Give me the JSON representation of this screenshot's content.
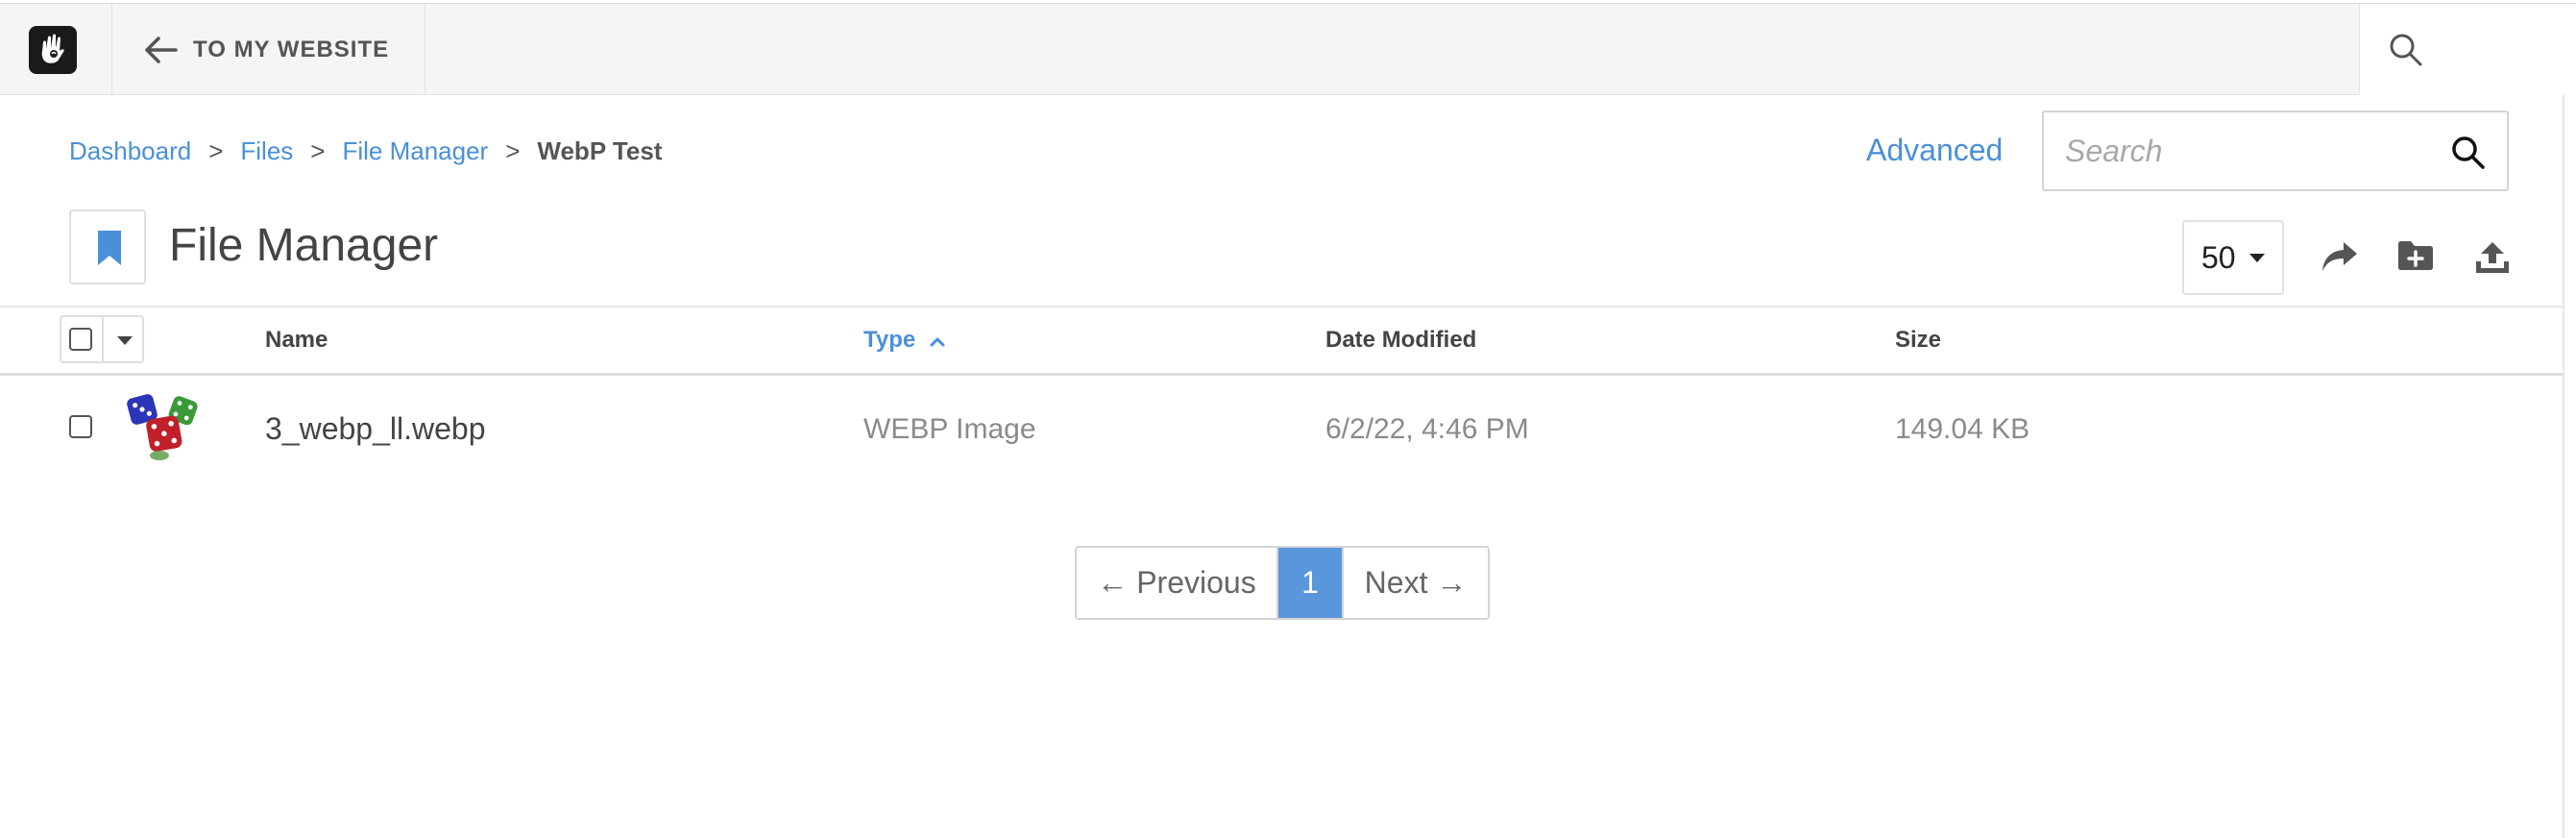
{
  "toolbar": {
    "back_label": "TO MY WEBSITE"
  },
  "breadcrumb": {
    "items": [
      "Dashboard",
      "Files",
      "File Manager"
    ],
    "separator": ">",
    "current": "WebP Test"
  },
  "header": {
    "advanced_label": "Advanced",
    "search_placeholder": "Search",
    "page_title": "File Manager",
    "per_page": "50"
  },
  "table": {
    "columns": {
      "name": "Name",
      "type": "Type",
      "date_modified": "Date Modified",
      "size": "Size"
    },
    "sorted_column": "type",
    "sort_direction": "ascending",
    "rows": [
      {
        "name": "3_webp_ll.webp",
        "type": "WEBP Image",
        "date_modified": "6/2/22, 4:46 PM",
        "size": "149.04 KB",
        "thumbnail": "dice-image"
      }
    ]
  },
  "pagination": {
    "previous_label": "← Previous",
    "current_page": "1",
    "next_label": "Next →"
  },
  "colors": {
    "accent": "#4a90d9",
    "active_page": "#5a96dc",
    "toolbar_bg": "#f5f5f5"
  },
  "icons": [
    "concrete-logo-icon",
    "back-arrow-icon",
    "search-icon",
    "bookmark-icon",
    "share-icon",
    "new-folder-icon",
    "upload-icon",
    "chevron-up-icon"
  ]
}
